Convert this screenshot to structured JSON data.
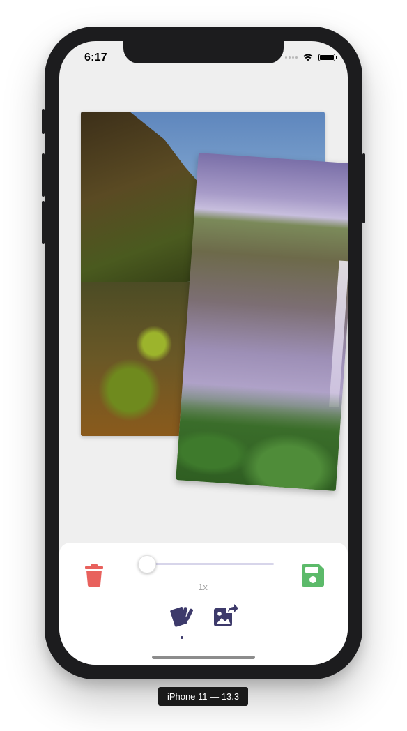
{
  "status_bar": {
    "time": "6:17",
    "icons": [
      "cellular-dots-icon",
      "wifi-icon",
      "battery-icon"
    ]
  },
  "canvas": {
    "photos": [
      {
        "name": "waterfall-cliff-plants-photo"
      },
      {
        "name": "misty-waterfall-photo"
      }
    ]
  },
  "toolbar": {
    "delete_icon": "trash-icon",
    "save_icon": "floppy-disk-icon",
    "zoom_label": "1x",
    "zoom_level_fraction": 0.0,
    "modes": [
      {
        "icon": "cards-icon",
        "selected": true
      },
      {
        "icon": "image-export-icon",
        "selected": false
      }
    ]
  },
  "colors": {
    "delete": "#e8615d",
    "save": "#5cba6a",
    "accent": "#3d3a6b",
    "slider_fill": "#9b94c6"
  },
  "device_label": "iPhone 11 — 13.3"
}
